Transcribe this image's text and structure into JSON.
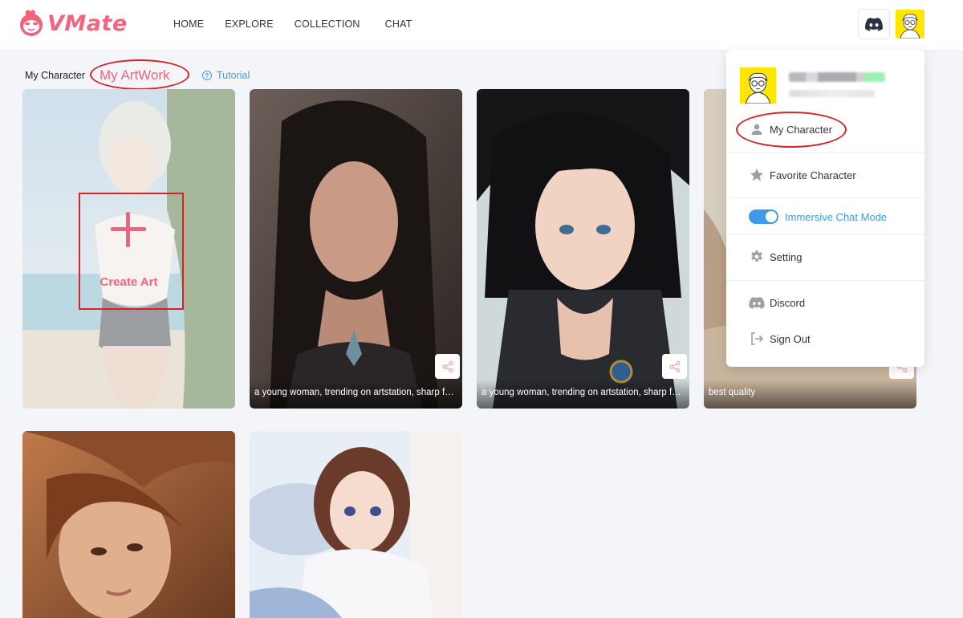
{
  "app": {
    "logo_text": "VMate",
    "brand_color": "#f3637d",
    "accent_color": "#3d9be9",
    "highlight_color": "#d62424"
  },
  "nav": {
    "items": [
      {
        "label": "HOME"
      },
      {
        "label": "EXPLORE"
      },
      {
        "label": "COLLECTION"
      },
      {
        "label": "CHAT"
      }
    ]
  },
  "subtabs": {
    "my_character": "My Character",
    "my_artwork": "My ArtWork",
    "tutorial": "Tutorial"
  },
  "create_card": {
    "label": "Create Art"
  },
  "artworks": [
    {
      "caption": "a young woman, trending on artstation, sharp focus, studio photo, intricate details"
    },
    {
      "caption": "a young woman, trending on artstation, sharp focus, studio photo, intricate details"
    },
    {
      "caption": "best quality"
    },
    {
      "caption": ""
    },
    {
      "caption": ""
    }
  ],
  "dropdown": {
    "items": {
      "my_character": "My Character",
      "favorite_character": "Favorite Character",
      "immersive_chat": "Immersive Chat Mode",
      "setting": "Setting",
      "discord": "Discord",
      "sign_out": "Sign Out"
    },
    "immersive_chat_enabled": true
  },
  "icons": {
    "discord": "discord-icon",
    "avatar": "avatar-image",
    "share": "share-icon",
    "user": "user-icon",
    "star": "star-icon",
    "gear": "gear-icon",
    "sign_out": "sign-out-icon",
    "help": "help-circle-icon"
  }
}
